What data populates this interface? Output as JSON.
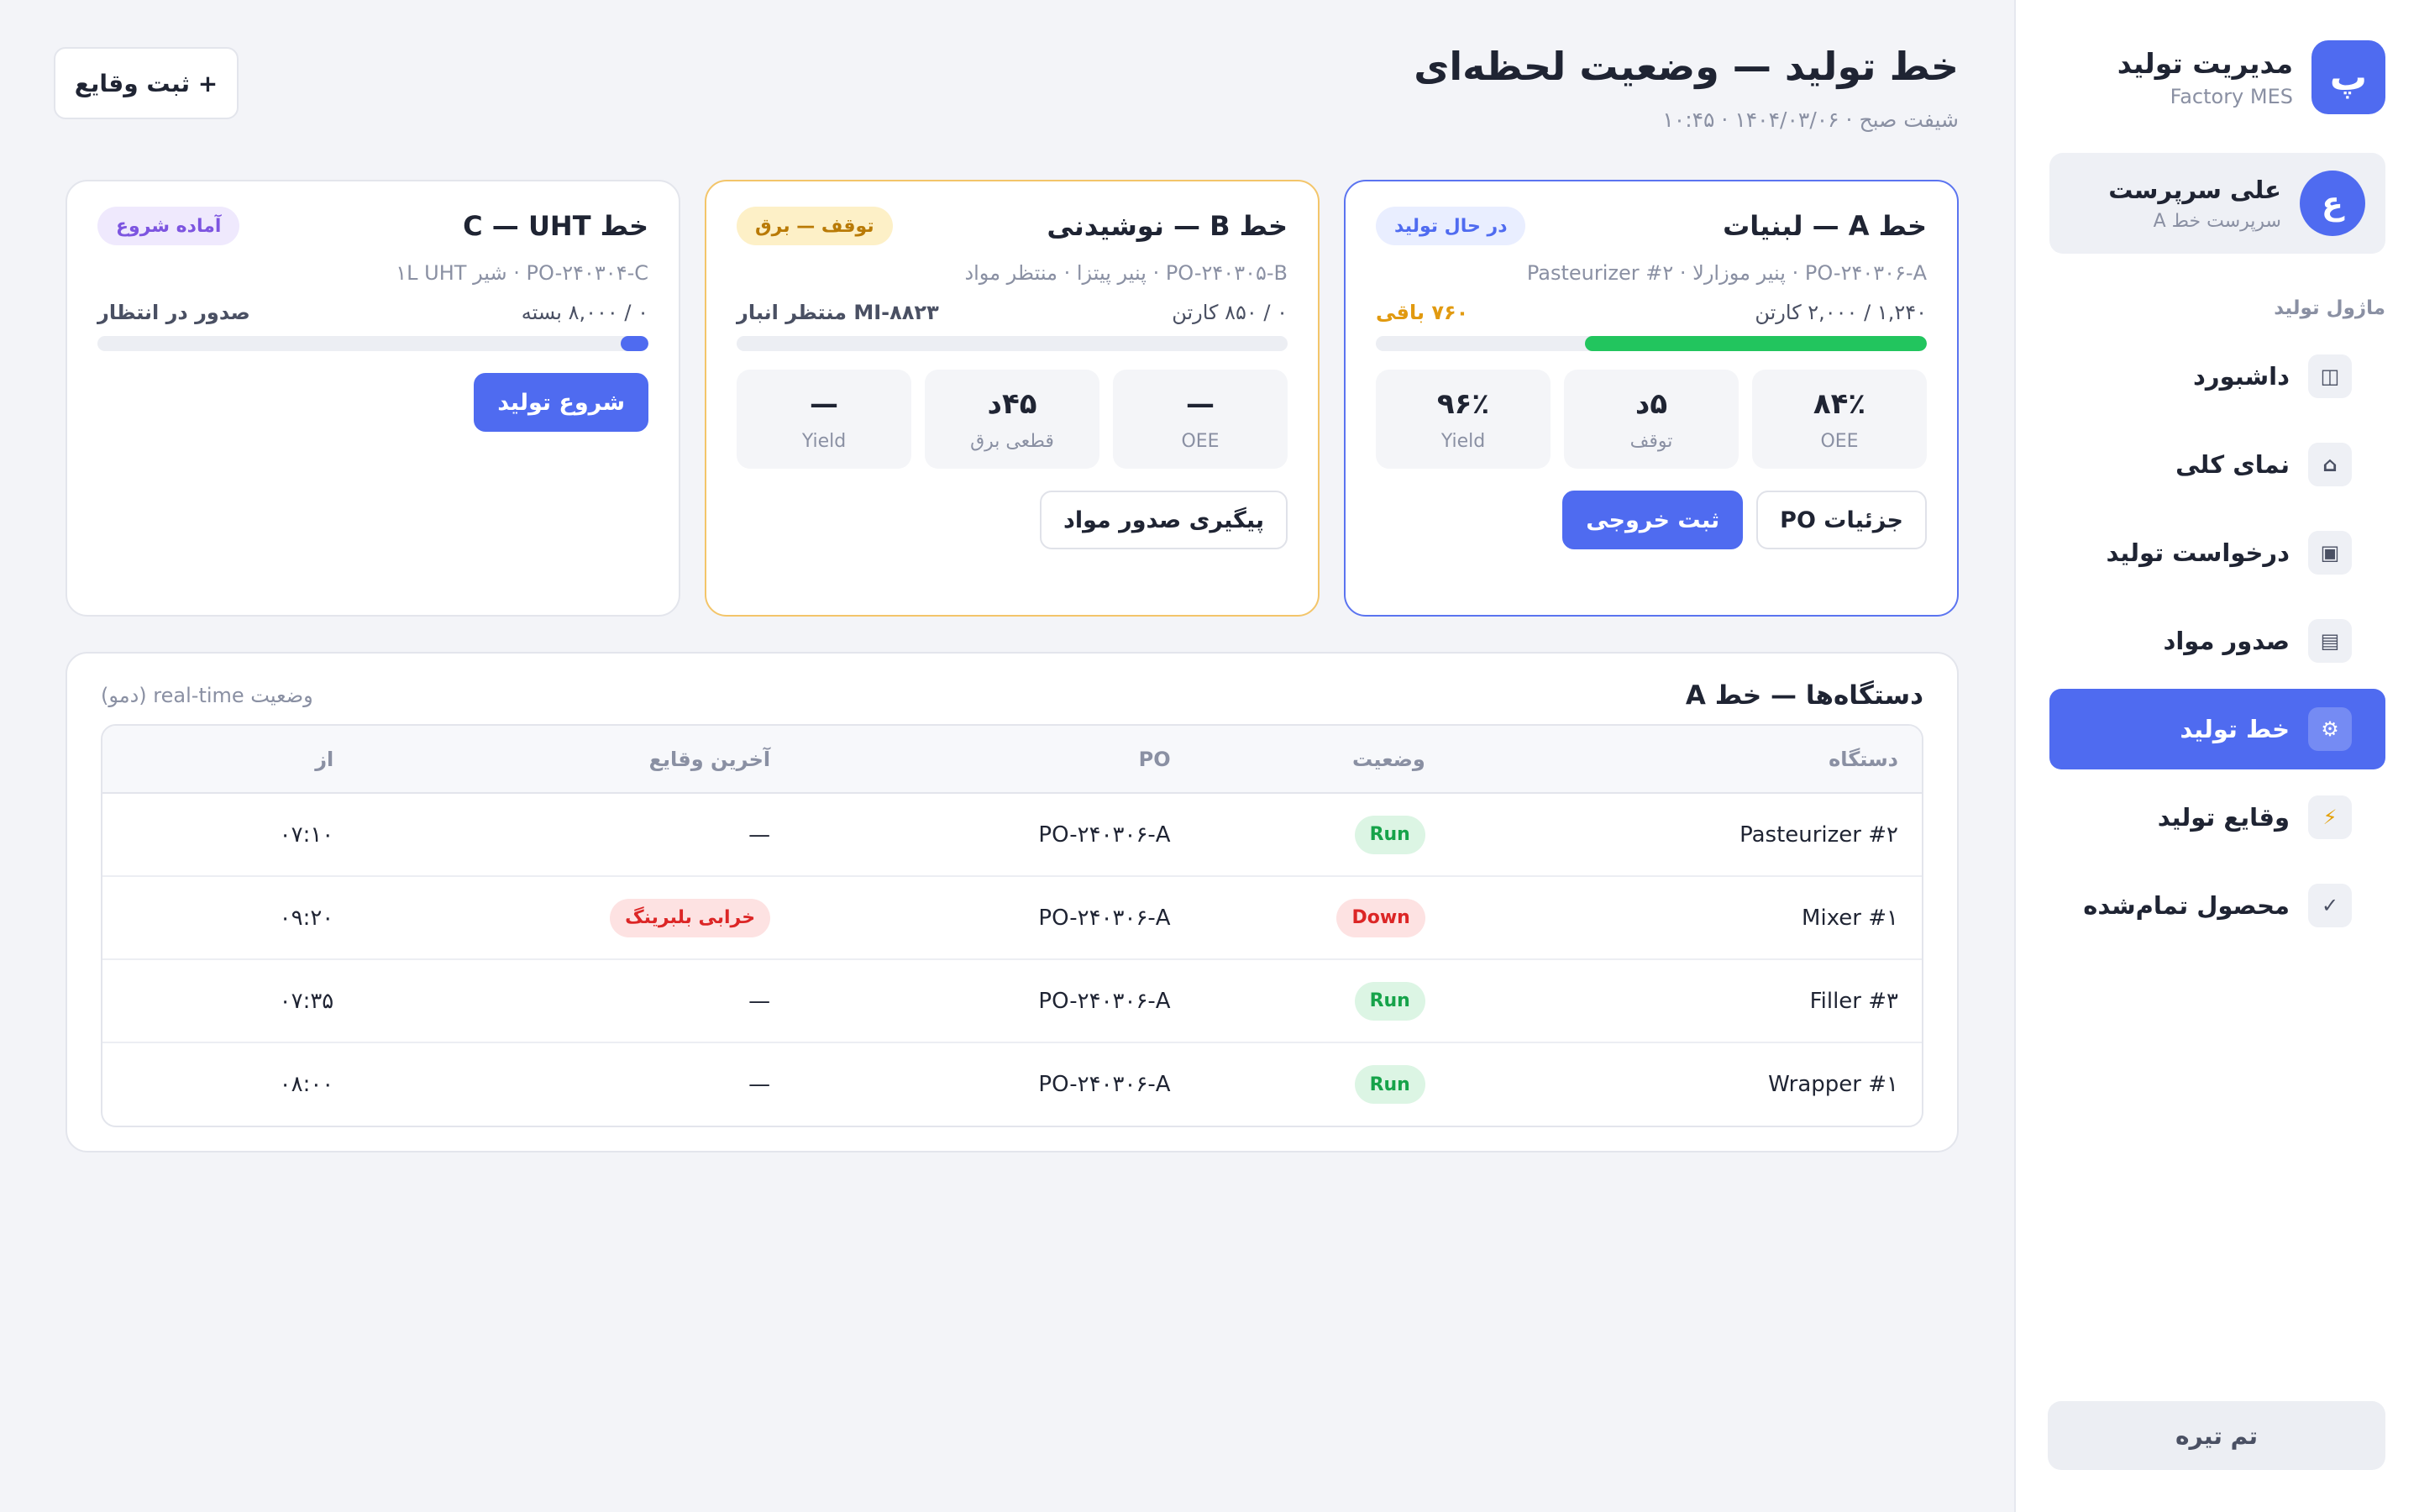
{
  "sidebar": {
    "brand": {
      "logo": "پ",
      "title": "مدیریت تولید",
      "subtitle": "Factory MES"
    },
    "user": {
      "avatar": "ع",
      "name": "علی سرپرست",
      "role": "سرپرست خط A"
    },
    "section_label": "ماژول تولید",
    "items": [
      {
        "label": "داشبورد",
        "icon": "◫",
        "icon_name": "dashboard-icon"
      },
      {
        "label": "نمای کلی",
        "icon": "⌂",
        "icon_name": "home-icon"
      },
      {
        "label": "درخواست تولید",
        "icon": "▣",
        "icon_name": "request-icon"
      },
      {
        "label": "صدور مواد",
        "icon": "▤",
        "icon_name": "list-icon"
      },
      {
        "label": "خط تولید",
        "icon": "⚙",
        "icon_name": "gear-icon",
        "active": true
      },
      {
        "label": "وقایع تولید",
        "icon": "⚡",
        "icon_name": "bolt-icon"
      },
      {
        "label": "محصول تمام‌شده",
        "icon": "✓",
        "icon_name": "check-icon"
      }
    ],
    "theme_button": "تم تیره"
  },
  "header": {
    "title": "خط تولید — وضعیت لحظه‌ای",
    "subtitle": "شیفت صبح · ۱۴۰۴/۰۳/۰۶ · ۱۰:۴۵",
    "add_event_button": "+ ثبت وقایع"
  },
  "lines": [
    {
      "title": "خط A — لبنیات",
      "status": "در حال تولید",
      "subtitle": "PO-۲۴۰۳۰۶-A · پنیر موزارلا · Pasteurizer #۲",
      "progress_text": "۱,۲۴۰ / ۲,۰۰۰ کارتن",
      "remaining_text": "۷۶۰ باقی",
      "progress_fraction": 0.62,
      "kpis": [
        {
          "value": "۸۴٪",
          "label": "OEE"
        },
        {
          "value": "۵د",
          "label": "توقف"
        },
        {
          "value": "۹۶٪",
          "label": "Yield"
        }
      ],
      "buttons": {
        "details": "جزئیات PO",
        "record_output": "ثبت خروجی"
      }
    },
    {
      "title": "خط B — نوشیدنی",
      "status": "توقف — برق",
      "subtitle": "PO-۲۴۰۳۰۵-B · پنیر پیتزا · منتظر مواد",
      "progress_text": "۰ / ۸۵۰ کارتن",
      "remaining_text": "MI-۸۸۲۳ منتظر انبار",
      "progress_fraction": 0,
      "kpis": [
        {
          "value": "—",
          "label": "OEE"
        },
        {
          "value": "۴۵د",
          "label": "قطعی برق"
        },
        {
          "value": "—",
          "label": "Yield"
        }
      ],
      "buttons": {
        "follow_up": "پیگیری صدور مواد"
      }
    },
    {
      "title": "خط C — UHT",
      "status": "آماده شروع",
      "subtitle": "PO-۲۴۰۳۰۴-C · شیر ۱L UHT",
      "progress_text": "۰ / ۸,۰۰۰ بسته",
      "remaining_text": "صدور در انتظار",
      "progress_fraction": 0.05,
      "buttons": {
        "start": "شروع تولید"
      }
    }
  ],
  "devices": {
    "title": "دستگاه‌ها — خط A",
    "note": "وضعیت real-time (دمو)",
    "columns": [
      "دستگاه",
      "وضعیت",
      "PO",
      "آخرین وقایع",
      "از"
    ],
    "rows": [
      {
        "device": "Pasteurizer #۲",
        "status": "Run",
        "po": "PO-۲۴۰۳۰۶-A",
        "last_event": "—",
        "since": "۰۷:۱۰"
      },
      {
        "device": "Mixer #۱",
        "status": "Down",
        "po": "PO-۲۴۰۳۰۶-A",
        "last_event": "خرابی بلبرینگ",
        "since": "۰۹:۲۰"
      },
      {
        "device": "Filler #۳",
        "status": "Run",
        "po": "PO-۲۴۰۳۰۶-A",
        "last_event": "—",
        "since": "۰۷:۳۵"
      },
      {
        "device": "Wrapper #۱",
        "status": "Run",
        "po": "PO-۲۴۰۳۰۶-A",
        "last_event": "—",
        "since": "۰۸:۰۰"
      }
    ]
  },
  "colors": {
    "accent": "#4f6bf0",
    "run": "#16a34a",
    "down": "#dc2626",
    "warning": "#e19a10"
  }
}
